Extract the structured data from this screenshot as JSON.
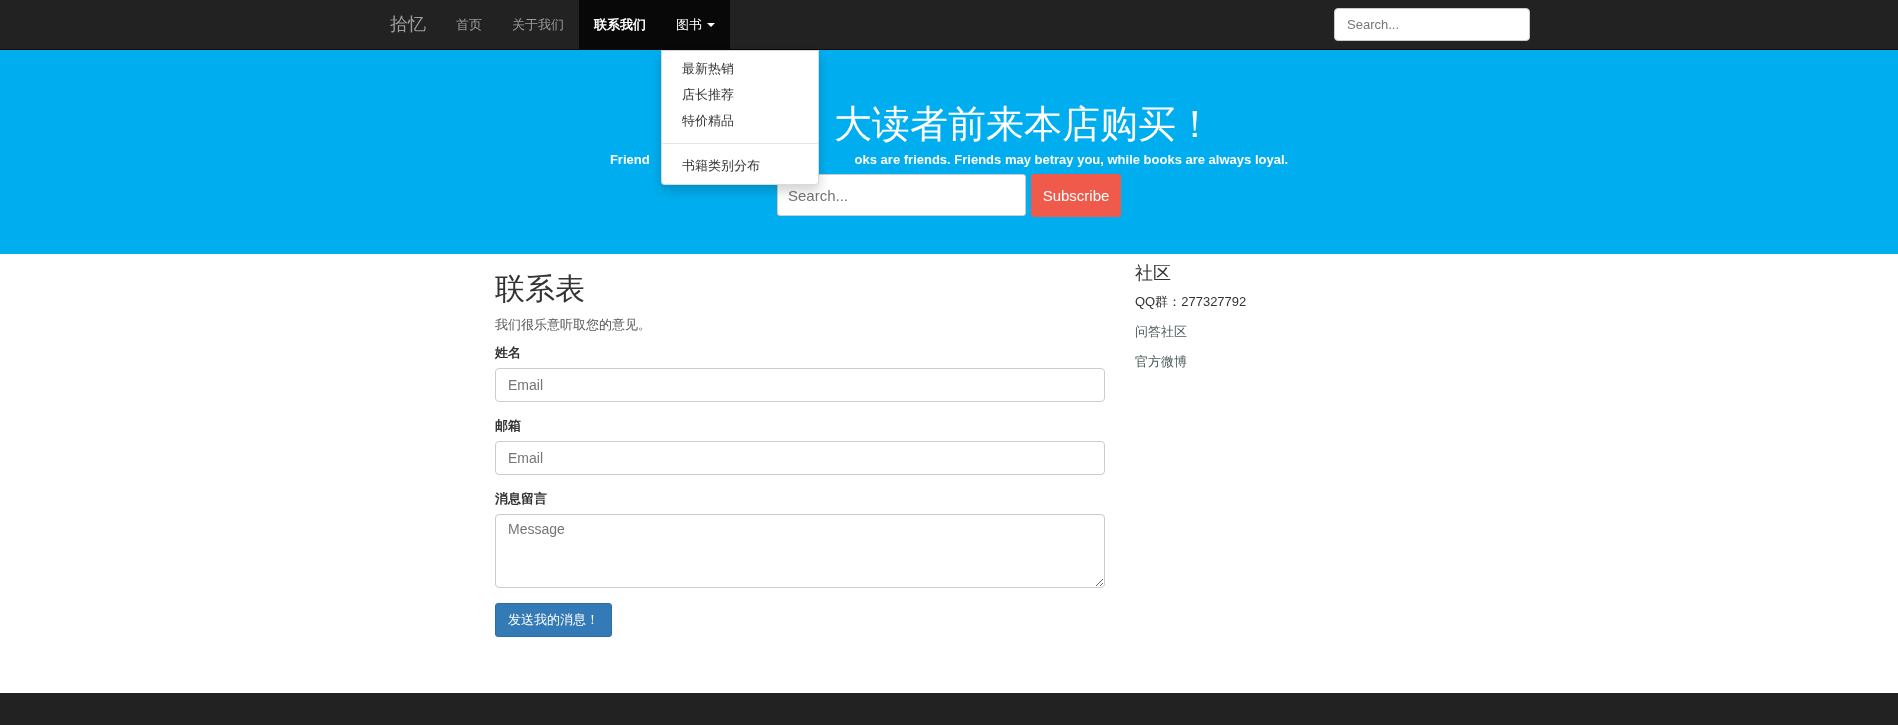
{
  "navbar": {
    "brand": "拾忆",
    "items": [
      {
        "label": "首页",
        "selected": false,
        "open": false
      },
      {
        "label": "关于我们",
        "selected": false,
        "open": false
      },
      {
        "label": "联系我们",
        "selected": true,
        "open": false
      },
      {
        "label": "图书",
        "selected": false,
        "open": true,
        "caret": true
      }
    ],
    "dropdown_groups": [
      [
        "最新热销",
        "店长推荐",
        "特价精品"
      ],
      [
        "书籍类别分布"
      ]
    ],
    "search": {
      "placeholder": "Search..."
    }
  },
  "hero": {
    "title": "大读者前来本店购买！",
    "subtitle_parts": [
      "Friend",
      "oks are friends. Friends may betray you, while books are always loyal."
    ],
    "search": {
      "placeholder": "Search..."
    },
    "button": "Subscribe"
  },
  "form": {
    "title": "联系表",
    "intro": "我们很乐意听取您的意见。",
    "fields": [
      {
        "label": "姓名",
        "kind": "input",
        "placeholder": "Email"
      },
      {
        "label": "邮箱",
        "kind": "input",
        "placeholder": "Email"
      },
      {
        "label": "消息留言",
        "kind": "textarea",
        "placeholder": "Message"
      }
    ],
    "submit": "发送我的消息！"
  },
  "sidebar": {
    "title": "社区",
    "items": [
      {
        "text": "QQ群：277327792",
        "kind": "text"
      },
      {
        "text": "问答社区",
        "kind": "link"
      },
      {
        "text": "官方微博",
        "kind": "link"
      }
    ]
  }
}
